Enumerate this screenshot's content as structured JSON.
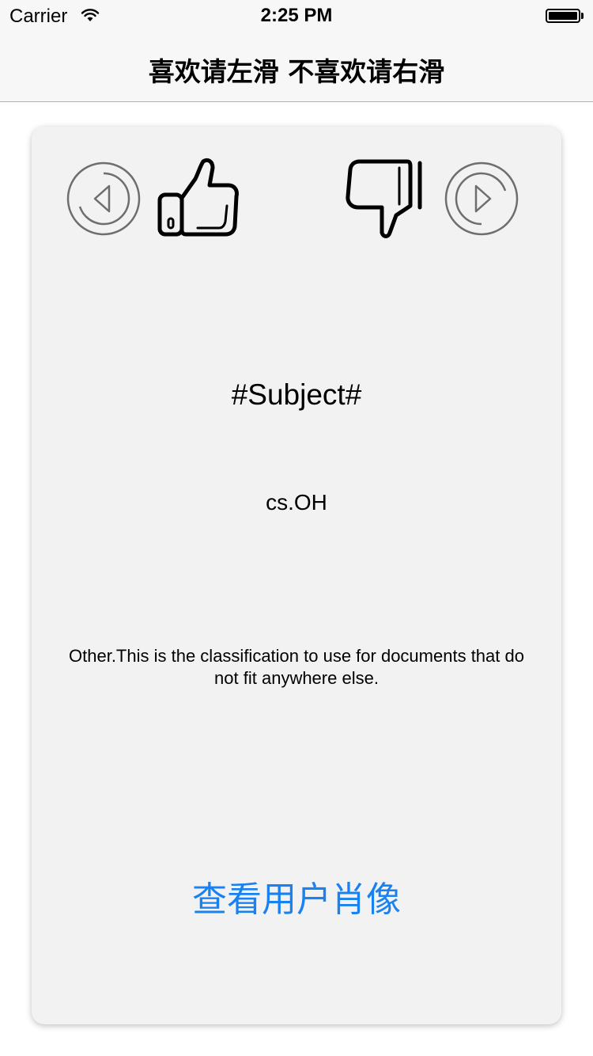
{
  "status_bar": {
    "carrier": "Carrier",
    "time": "2:25 PM",
    "icons": [
      "wifi-icon",
      "battery-icon"
    ]
  },
  "nav": {
    "title": "喜欢请左滑 不喜欢请右滑"
  },
  "card": {
    "subject": "#Subject#",
    "code": "cs.OH",
    "description": "Other.This is the classification to use for documents that do not fit anywhere else.",
    "profile_link": "查看用户肖像",
    "controls": [
      "previous-icon",
      "thumbs-up-icon",
      "thumbs-down-icon",
      "next-icon"
    ]
  },
  "colors": {
    "nav_background": "#f7f7f7",
    "card_background": "#f2f2f2",
    "link": "#1a82f0",
    "icon_gray": "#6e6e6e"
  }
}
